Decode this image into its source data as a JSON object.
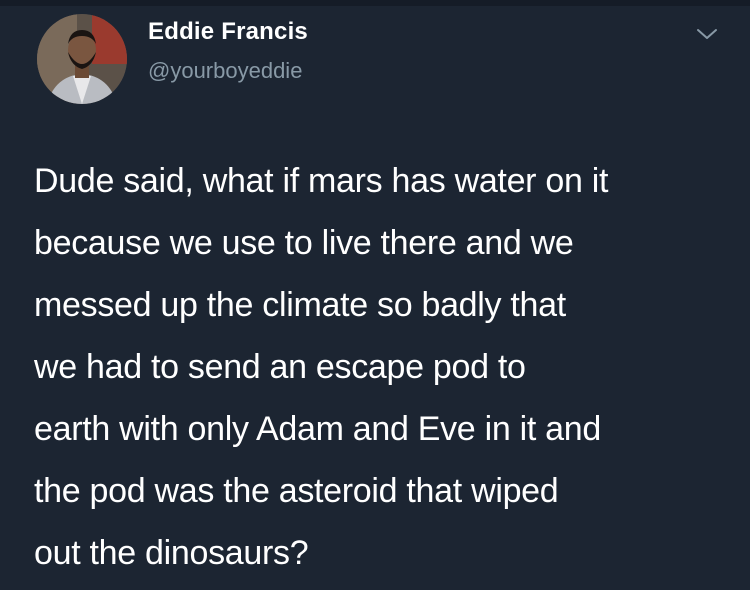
{
  "tweet": {
    "author": {
      "display_name": "Eddie Francis",
      "handle": "@yourboyeddie",
      "avatar_icon": "user-avatar-photo"
    },
    "menu_icon": "chevron-down-icon",
    "text_lines": [
      "Dude said, what if mars has water on it",
      "because we use to live there and we",
      "messed up the climate so badly that",
      "we had to send an escape pod to",
      "earth with only Adam and Eve in it and",
      "the pod was the asteroid that wiped",
      "out the dinosaurs?"
    ]
  },
  "colors": {
    "background": "#1c2532",
    "text": "#ffffff",
    "secondary_text": "#8899a6"
  }
}
